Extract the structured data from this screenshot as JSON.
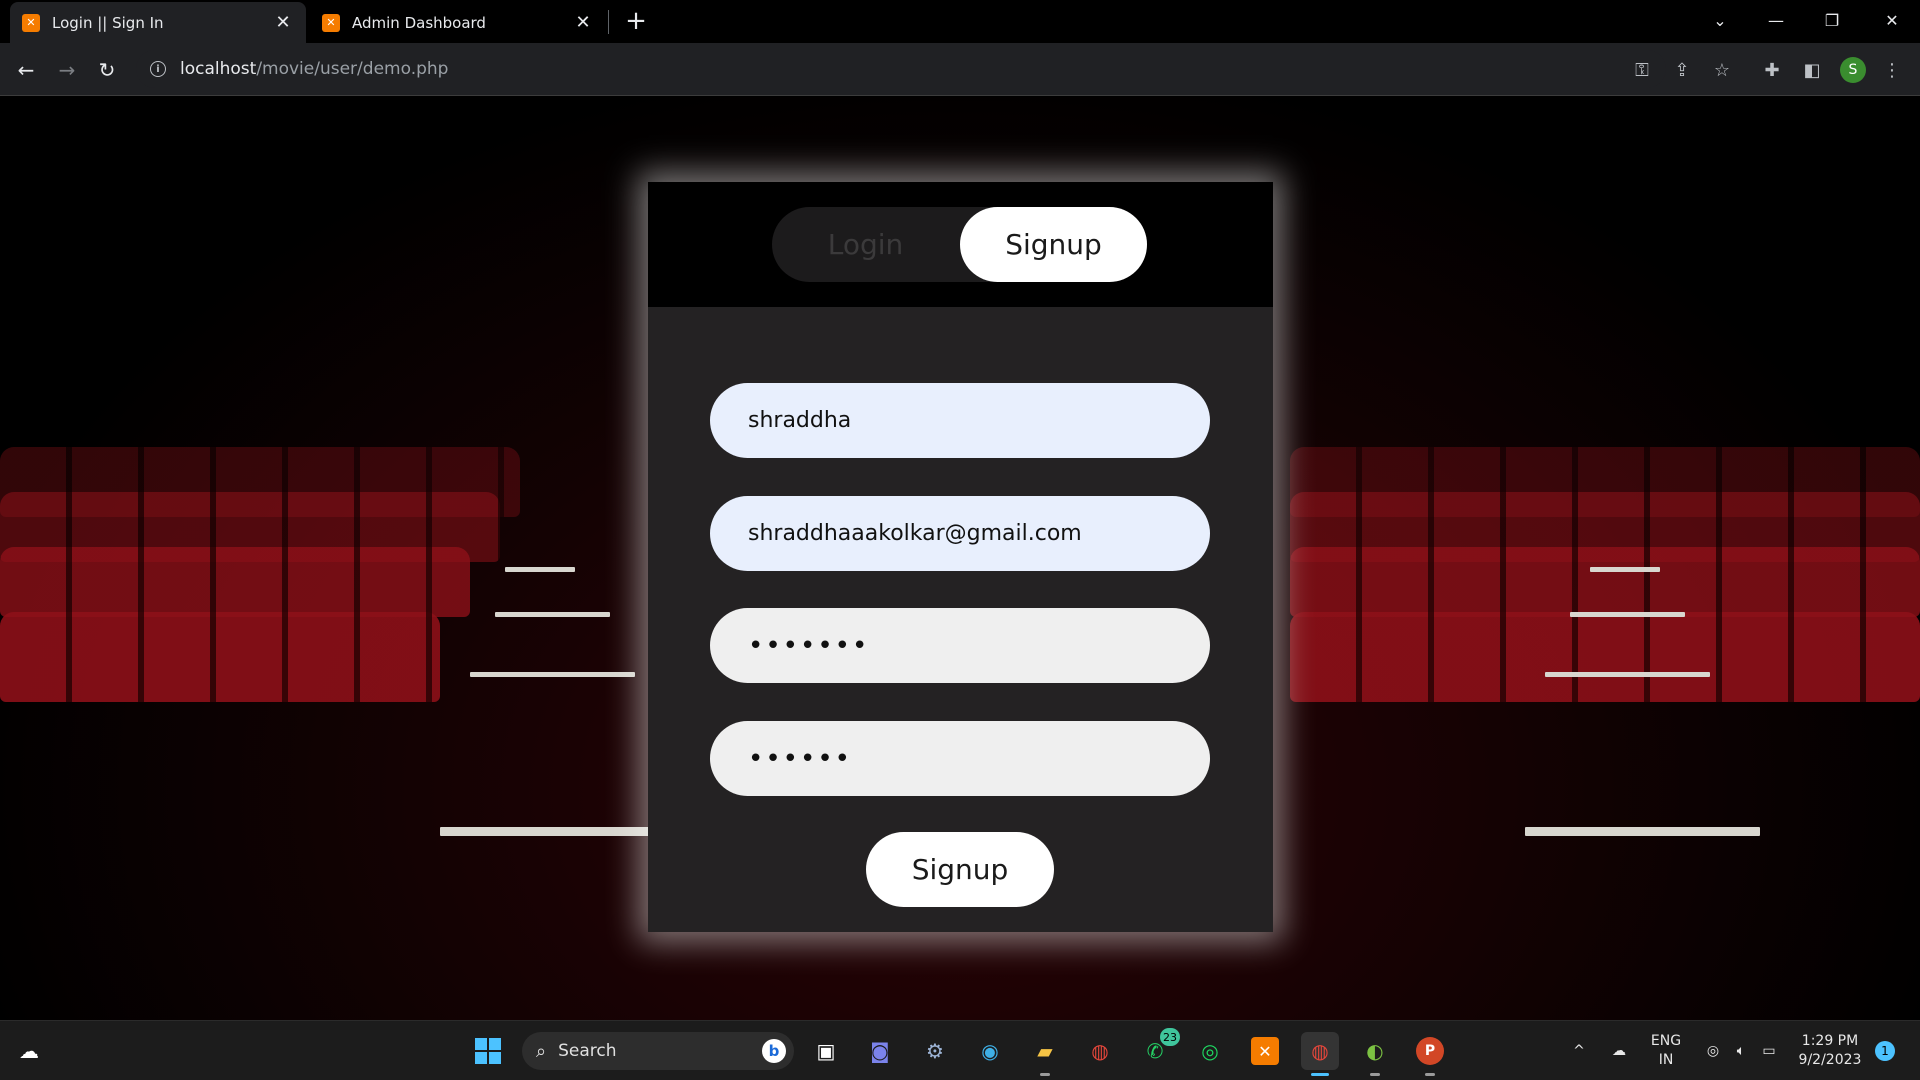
{
  "browser": {
    "tabs": [
      {
        "title": "Login || Sign In",
        "active": true
      },
      {
        "title": "Admin Dashboard",
        "active": false
      }
    ],
    "url_host": "localhost",
    "url_path": "/movie/user/demo.php",
    "profile_initial": "S"
  },
  "auth": {
    "toggle": {
      "login_label": "Login",
      "signup_label": "Signup",
      "selected": "Signup"
    },
    "fields": {
      "username_value": "shraddha",
      "email_value": "shraddhaaakolkar@gmail.com",
      "password_value": "•••••••",
      "confirm_password_value": "••••••"
    },
    "submit_label": "Signup"
  },
  "taskbar": {
    "search_label": "Search",
    "whatsapp_badge": "23",
    "language_line1": "ENG",
    "language_line2": "IN",
    "time": "1:29 PM",
    "date": "9/2/2023",
    "notification_count": "1"
  },
  "colors": {
    "card_bg": "#242223",
    "autofill_bg": "#e8effd",
    "seat_red": "#8d1018",
    "accent_blue": "#4cc2ff"
  }
}
